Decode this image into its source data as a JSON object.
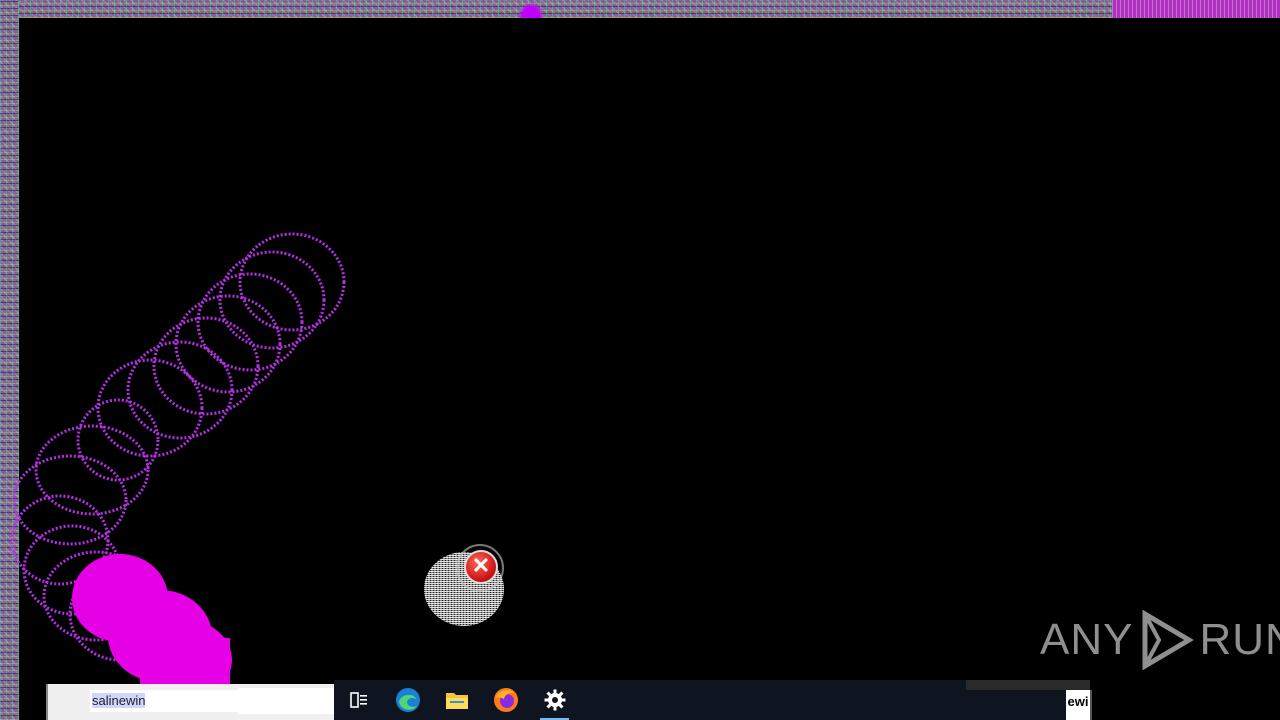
{
  "screen": {
    "background_color": "#000000",
    "accent_color": "#b530e6",
    "trail_fill_color": "#e600e6"
  },
  "error_icon": {
    "glyph": "✕",
    "icon": "error-x-icon"
  },
  "watermark": {
    "text_left": "ANY",
    "text_right": "RUN"
  },
  "taskbar": {
    "search_field_value": "salinewin",
    "items": [
      {
        "name": "task-view-button",
        "icon": "task-view-icon"
      },
      {
        "name": "edge-button",
        "icon": "edge-icon"
      },
      {
        "name": "file-explorer-button",
        "icon": "folder-icon"
      },
      {
        "name": "firefox-button",
        "icon": "firefox-icon"
      },
      {
        "name": "settings-button",
        "icon": "gear-icon",
        "active": true
      }
    ],
    "tray_text": "ewi"
  }
}
